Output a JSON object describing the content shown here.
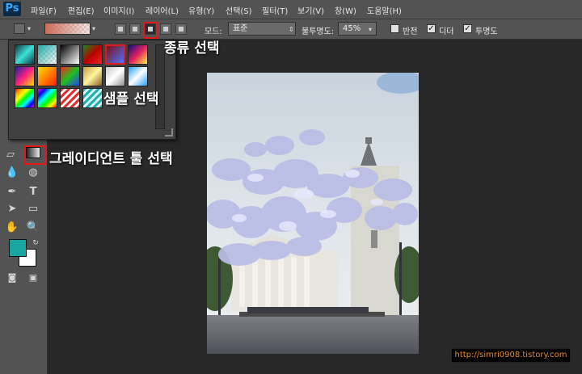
{
  "app": {
    "logo": "Ps"
  },
  "menubar": {
    "items": [
      "파일(F)",
      "편집(E)",
      "이미지(I)",
      "레이어(L)",
      "유형(Y)",
      "선택(S)",
      "필터(T)",
      "보기(V)",
      "창(W)",
      "도움말(H)"
    ]
  },
  "options": {
    "mode_label": "모드:",
    "mode_value": "표준",
    "opacity_label": "불투명도:",
    "opacity_value": "45%",
    "reverse_label": "반전",
    "dither_label": "디더",
    "transparency_label": "투명도",
    "reverse_checked": false,
    "dither_checked": true,
    "transparency_checked": true
  },
  "annotations": {
    "type_select": "종류 선택",
    "sample_select": "샘플 선택",
    "tool_select": "그레이디언트 툴 선택"
  },
  "watermark": {
    "url": "http://simri0908.tistory.com"
  },
  "colors": {
    "foreground": "#1aa6a0",
    "background": "#ffffff",
    "highlight": "#e01a1a"
  },
  "icons": [
    "gradient-tool-icon",
    "pen-icon",
    "type-icon",
    "path-select-icon",
    "rectangle-icon",
    "hand-icon",
    "zoom-icon",
    "quick-mask-icon",
    "screen-mode-icon"
  ]
}
